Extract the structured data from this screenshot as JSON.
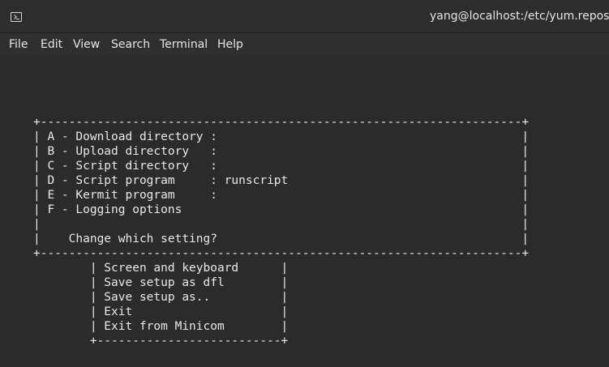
{
  "window": {
    "title": "yang@localhost:/etc/yum.repos.d"
  },
  "menubar": {
    "items": [
      {
        "label": "File"
      },
      {
        "label": "Edit"
      },
      {
        "label": "View"
      },
      {
        "label": "Search"
      },
      {
        "label": "Terminal"
      },
      {
        "label": "Help"
      }
    ]
  },
  "terminal": {
    "lines": [
      "+--------------------------------------------------------------------+",
      "| A - Download directory :                                           |",
      "| B - Upload directory   :                                           |",
      "| C - Script directory   :                                           |",
      "| D - Script program     : runscript                                 |",
      "| E - Kermit program     :                                           |",
      "| F - Logging options                                                |",
      "|                                                                    |",
      "|    Change which setting?                                           |",
      "+--------------------------------------------------------------------+",
      "        | Screen and keyboard      |",
      "        | Save setup as dfl        |",
      "        | Save setup as..          |",
      "        | Exit                     |",
      "        | Exit from Minicom        |",
      "        +--------------------------+"
    ]
  }
}
